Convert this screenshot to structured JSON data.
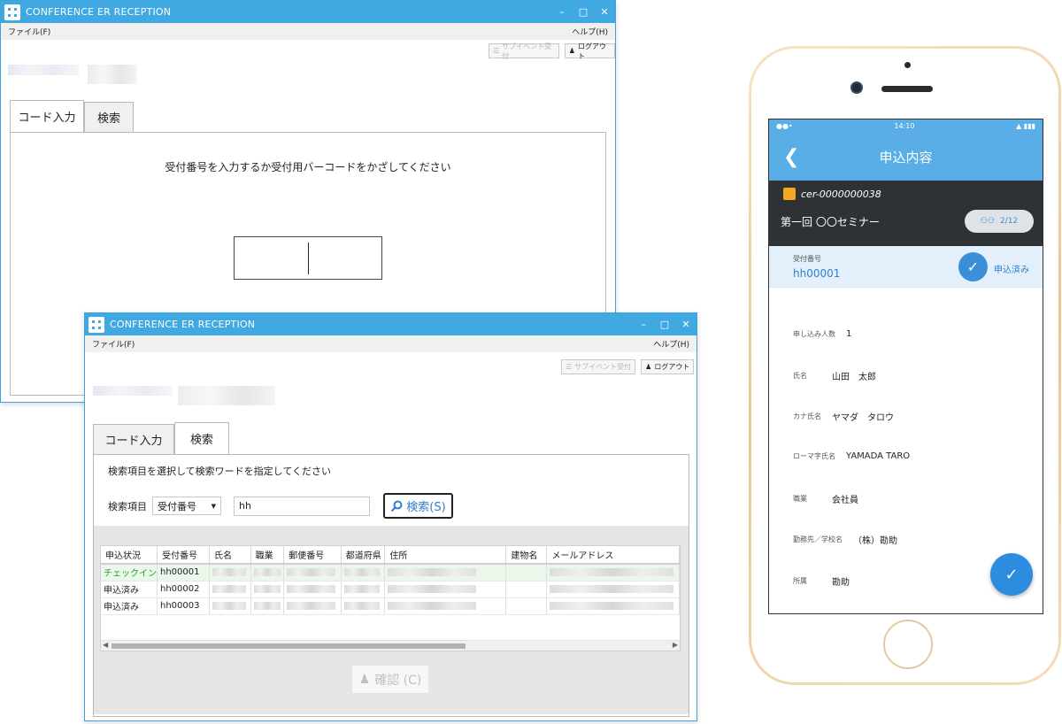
{
  "window1": {
    "title": "CONFERENCE ER RECEPTION",
    "menu_file": "ファイル(F)",
    "menu_help": "ヘルプ(H)",
    "subevent_label": "サブイベント受付",
    "logout_label": "ログアウト",
    "tabs": [
      "コード入力",
      "検索"
    ],
    "prompt": "受付番号を入力するか受付用バーコードをかざしてください"
  },
  "window2": {
    "title": "CONFERENCE ER RECEPTION",
    "menu_file": "ファイル(F)",
    "menu_help": "ヘルプ(H)",
    "subevent_label": "サブイベント受付",
    "logout_label": "ログアウト",
    "tabs": [
      "コード入力",
      "検索"
    ],
    "prompt": "検索項目を選択して検索ワードを指定してください",
    "search_label": "検索項目",
    "search_field": "受付番号",
    "search_value": "hh",
    "search_button": "検索(S)",
    "columns": [
      "申込状況",
      "受付番号",
      "氏名",
      "職業",
      "郵便番号",
      "都道府県",
      "住所",
      "建物名",
      "メールアドレス"
    ],
    "rows": [
      {
        "status": "チェックイン",
        "number": "hh00001"
      },
      {
        "status": "申込済み",
        "number": "hh00002"
      },
      {
        "status": "申込済み",
        "number": "hh00003"
      }
    ],
    "confirm_button": "確認 (C)"
  },
  "phone": {
    "time": "14:10",
    "title": "申込内容",
    "event_code": "cer-0000000038",
    "event_name": "第一回 〇〇セミナー",
    "count": "2/12",
    "receipt_label": "受付番号",
    "receipt_value": "hh00001",
    "receipt_status": "申込済み",
    "fields": [
      {
        "label": "申し込み人数",
        "value": "1"
      },
      {
        "label": "氏名",
        "value": "山田　太郎"
      },
      {
        "label": "カナ氏名",
        "value": "ヤマダ　タロウ"
      },
      {
        "label": "ローマ字氏名",
        "value": "YAMADA TARO"
      },
      {
        "label": "職業",
        "value": "会社員"
      },
      {
        "label": "勤務先／学校名",
        "value": "（株）勘助"
      },
      {
        "label": "所属",
        "value": "勘助"
      }
    ]
  },
  "colors": {
    "titlebar": "#41a9e1",
    "phone_header": "#5aaee8",
    "event_bar": "#2f3234",
    "accent_blue": "#2d7fd0",
    "checkin_green": "#2a9d2a"
  }
}
